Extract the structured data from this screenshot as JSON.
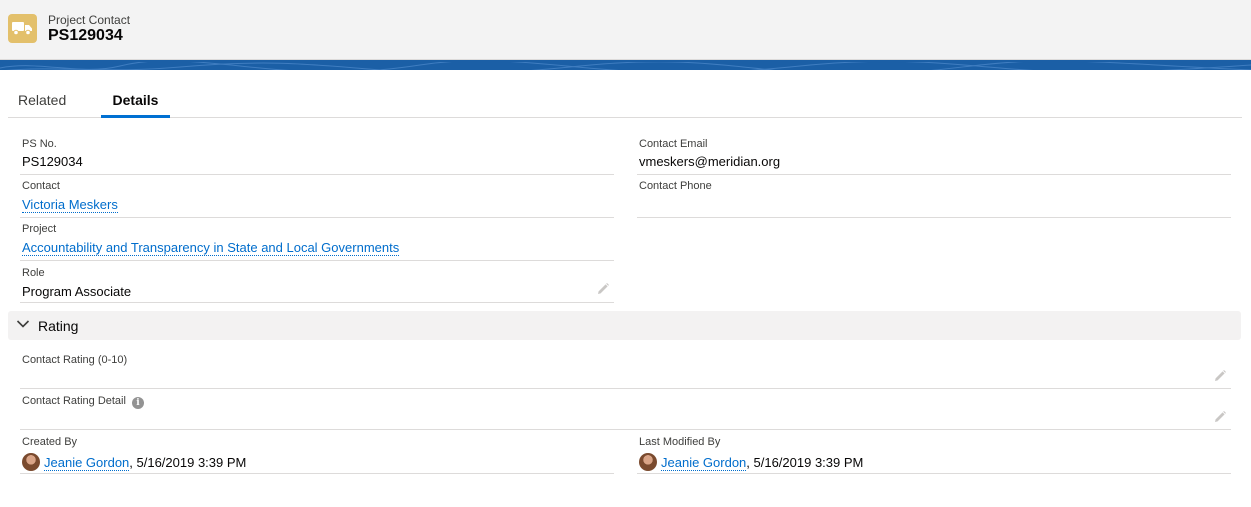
{
  "header": {
    "object_type": "Project Contact",
    "record_name": "PS129034",
    "icon": "truck-icon",
    "icon_color": "#e3c06b"
  },
  "banner_color": "#1b5fa6",
  "tabs": [
    {
      "label": "Related",
      "active": false
    },
    {
      "label": "Details",
      "active": true
    }
  ],
  "details": {
    "ps_no": {
      "label": "PS No.",
      "value": "PS129034"
    },
    "contact_email": {
      "label": "Contact Email",
      "value": "vmeskers@meridian.org"
    },
    "contact": {
      "label": "Contact",
      "value": "Victoria Meskers"
    },
    "contact_phone": {
      "label": "Contact Phone",
      "value": ""
    },
    "project": {
      "label": "Project",
      "value": "Accountability and Transparency in State and Local Governments"
    },
    "role": {
      "label": "Role",
      "value": "Program Associate"
    }
  },
  "rating_section": {
    "title": "Rating",
    "contact_rating": {
      "label": "Contact Rating (0-10)",
      "value": ""
    },
    "contact_rating_detail": {
      "label": "Contact Rating Detail",
      "value": ""
    }
  },
  "system": {
    "created_by": {
      "label": "Created By",
      "user": "Jeanie Gordon",
      "date": ", 5/16/2019 3:39 PM"
    },
    "last_modified_by": {
      "label": "Last Modified By",
      "user": "Jeanie Gordon",
      "date": ", 5/16/2019 3:39 PM"
    }
  },
  "link_color": "#006dcc",
  "active_tab_color": "#0070d2"
}
